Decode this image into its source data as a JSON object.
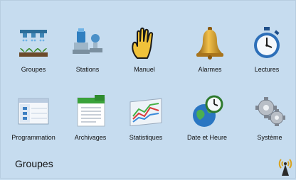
{
  "menu": {
    "row1": [
      {
        "label": "Groupes",
        "icon": "sprinkler-plants-icon"
      },
      {
        "label": "Stations",
        "icon": "valve-station-icon"
      },
      {
        "label": "Manuel",
        "icon": "hand-icon"
      },
      {
        "label": "Alarmes",
        "icon": "bell-icon"
      },
      {
        "label": "Lectures",
        "icon": "stopwatch-icon"
      }
    ],
    "row2": [
      {
        "label": "Programmation",
        "icon": "schedule-window-icon"
      },
      {
        "label": "Archivages",
        "icon": "document-archive-icon"
      },
      {
        "label": "Statistiques",
        "icon": "statistics-chart-icon"
      },
      {
        "label": "Date et Heure",
        "icon": "globe-clock-icon"
      },
      {
        "label": "Système",
        "icon": "gears-icon"
      }
    ]
  },
  "footer": {
    "current_section": "Groupes",
    "status_icon": "signal-antenna-icon"
  },
  "colors": {
    "background": "#c8def0",
    "accent_gold": "#d9a21c"
  }
}
